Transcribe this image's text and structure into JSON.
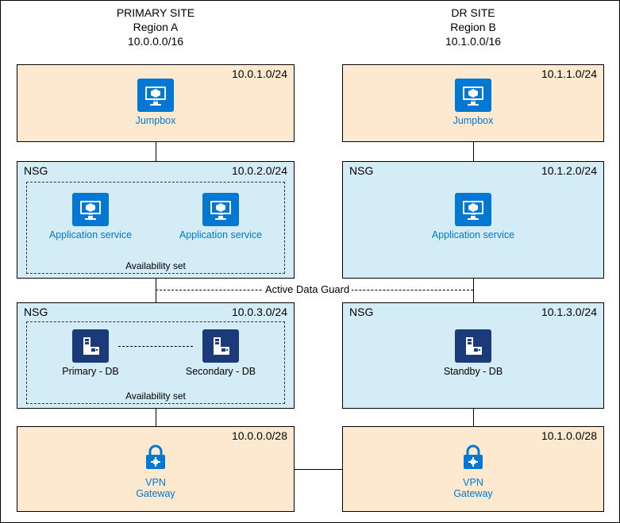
{
  "primary": {
    "title1": "PRIMARY SITE",
    "title2": "Region A",
    "title3": "10.0.0.0/16",
    "tier1_cidr": "10.0.1.0/24",
    "tier2_nsg": "NSG",
    "tier2_cidr": "10.0.2.0/24",
    "tier3_nsg": "NSG",
    "tier3_cidr": "10.0.3.0/24",
    "tier4_cidr": "10.0.0.0/28",
    "jumpbox": "Jumpbox",
    "app1": "Application service",
    "app2": "Application service",
    "avset": "Availability set",
    "db1": "Primary - DB",
    "db2": "Secondary - DB",
    "vpn1": "VPN",
    "vpn2": "Gateway"
  },
  "dr": {
    "title1": "DR SITE",
    "title2": "Region B",
    "title3": "10.1.0.0/16",
    "tier1_cidr": "10.1.1.0/24",
    "tier2_nsg": "NSG",
    "tier2_cidr": "10.1.2.0/24",
    "tier3_nsg": "NSG",
    "tier3_cidr": "10.1.3.0/24",
    "tier4_cidr": "10.1.0.0/28",
    "jumpbox": "Jumpbox",
    "app": "Application service",
    "db": "Standby - DB",
    "vpn1": "VPN",
    "vpn2": "Gateway"
  },
  "adg_label": "Active Data Guard"
}
